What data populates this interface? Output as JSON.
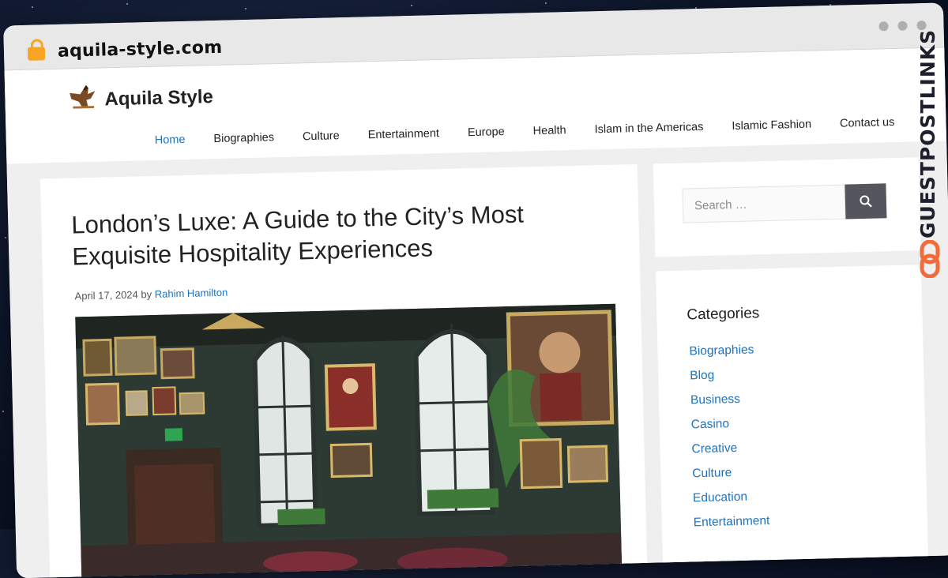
{
  "browser": {
    "url": "aquila-style.com"
  },
  "site": {
    "title": "Aquila Style"
  },
  "nav": {
    "items": [
      {
        "label": "Home",
        "active": true
      },
      {
        "label": "Biographies"
      },
      {
        "label": "Culture"
      },
      {
        "label": "Entertainment"
      },
      {
        "label": "Europe"
      },
      {
        "label": "Health"
      },
      {
        "label": "Islam in the Americas"
      },
      {
        "label": "Islamic Fashion"
      },
      {
        "label": "Contact us"
      }
    ]
  },
  "post": {
    "title": "London’s Luxe: A Guide to the City’s Most Exquisite Hospitality Experiences",
    "date": "April 17, 2024",
    "by": "by",
    "author": "Rahim Hamilton"
  },
  "sidebar": {
    "search_placeholder": "Search …",
    "categories_heading": "Categories",
    "categories": [
      "Biographies",
      "Blog",
      "Business",
      "Casino",
      "Creative",
      "Culture",
      "Education",
      "Entertainment"
    ]
  },
  "badge": {
    "text": "GUESTPOSTLINKS"
  },
  "colors": {
    "link": "#1e73be",
    "search_button": "#55555e",
    "badge_accent": "#f26b3a",
    "lock": "#f6a623"
  }
}
